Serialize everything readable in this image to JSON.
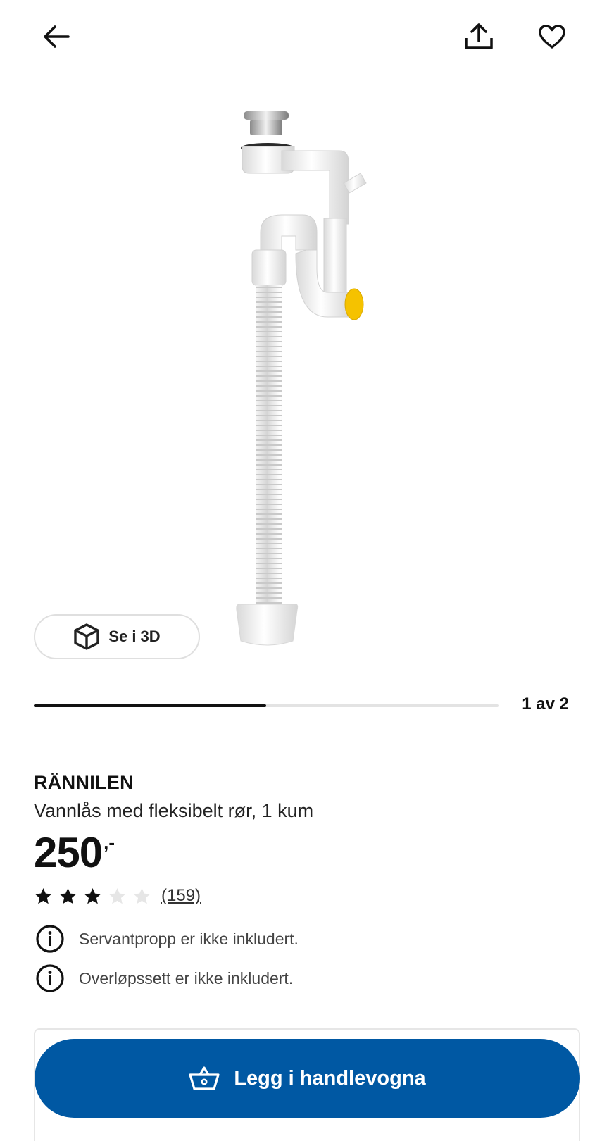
{
  "header": {
    "back_icon": "arrow-left-icon",
    "share_icon": "share-icon",
    "favorite_icon": "heart-icon"
  },
  "gallery": {
    "view_3d_label": "Se i 3D",
    "view_3d_icon": "cube-icon",
    "current": 1,
    "total": 2,
    "counter_label": "1 av 2",
    "progress_fraction": 0.5
  },
  "product": {
    "brand": "RÄNNILEN",
    "description": "Vannlås med fleksibelt rør, 1 kum",
    "price_integer": "250",
    "price_decimal": ",-",
    "rating": 3,
    "rating_max": 5,
    "review_count": "(159)"
  },
  "notices": [
    {
      "icon": "info-icon",
      "text": "Servantpropp er ikke inkludert."
    },
    {
      "icon": "info-icon",
      "text": "Overløpssett er ikke inkludert."
    }
  ],
  "cart": {
    "button_label": "Legg i handlevogna",
    "icon": "basket-icon"
  },
  "colors": {
    "primary": "#0058a3",
    "text": "#111111",
    "accent_yellow": "#f5c200"
  }
}
